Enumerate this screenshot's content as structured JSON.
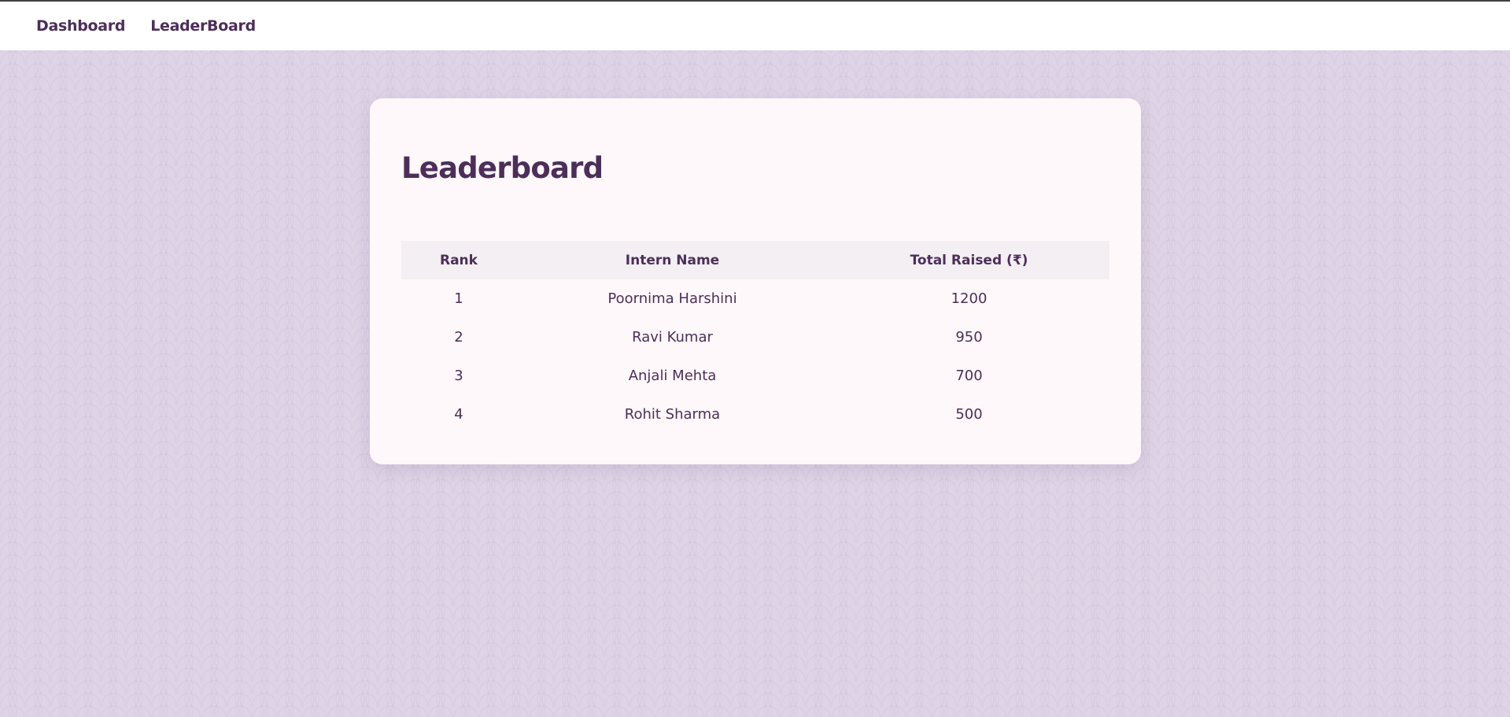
{
  "nav": {
    "links": [
      "Dashboard",
      "LeaderBoard"
    ]
  },
  "leaderboard": {
    "title": "Leaderboard",
    "columns": [
      "Rank",
      "Intern Name",
      "Total Raised (₹)"
    ],
    "rows": [
      {
        "rank": "1",
        "name": "Poornima Harshini",
        "total": "1200"
      },
      {
        "rank": "2",
        "name": "Ravi Kumar",
        "total": "950"
      },
      {
        "rank": "3",
        "name": "Anjali Mehta",
        "total": "700"
      },
      {
        "rank": "4",
        "name": "Rohit Sharma",
        "total": "500"
      }
    ]
  },
  "colors": {
    "accent": "#4d2e5a",
    "background": "#dfd4e6",
    "card": "#fff8fa",
    "table_header": "#f3eff2"
  }
}
